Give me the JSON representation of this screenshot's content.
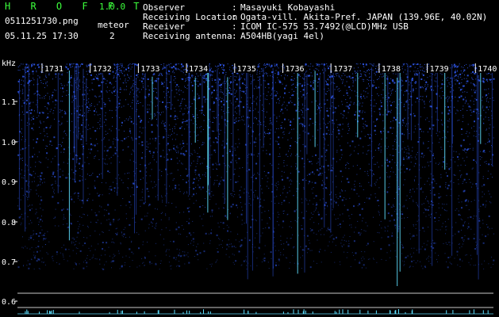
{
  "app": {
    "title": "H R O F F T",
    "version": "1.0.0",
    "filename": "0511251730.png",
    "datetime": "05.11.25 17:30"
  },
  "meteor": {
    "label": "meteor",
    "count": "2"
  },
  "info": [
    {
      "key": "Observer",
      "value": "Masayuki Kobayashi"
    },
    {
      "key": "Receiving Location",
      "value": "Ogata-vill. Akita-Pref. JAPAN (139.96E, 40.02N)"
    },
    {
      "key": "Receiver",
      "value": "ICOM IC-575 53.7492(@LCD)MHz USB"
    },
    {
      "key": "Receiving antenna",
      "value": "A504HB(yagi 4el)"
    }
  ],
  "chart_data": {
    "type": "heatmap",
    "ylabel": "kHz",
    "y_ticks": [
      "1.1",
      "1.0",
      "0.9",
      "0.8",
      "0.7",
      "0.6"
    ],
    "x_ticks": [
      "1731",
      "1732",
      "1733",
      "1734",
      "1735",
      "1736",
      "1737",
      "1738",
      "1739",
      "1740"
    ],
    "colors": {
      "background": "#000000",
      "signal": "#2a4fd6",
      "meteor_echo": "#5fe0ff",
      "labels": "#ffffff",
      "header": "#3cff3c"
    }
  }
}
